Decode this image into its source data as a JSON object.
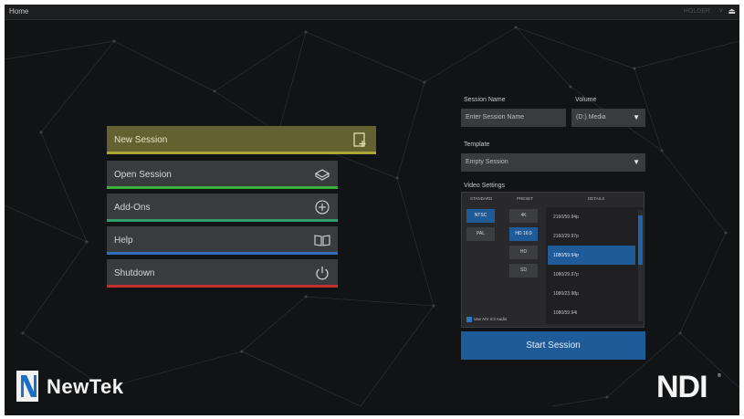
{
  "window": {
    "title": "Home",
    "right_text": "HOLDER",
    "right_chevron": "˅",
    "eject_glyph": "⏏"
  },
  "menu": {
    "items": [
      {
        "label": "New Session",
        "icon": "new-session-icon",
        "accent": "#a9a836"
      },
      {
        "label": "Open Session",
        "icon": "open-session-icon",
        "accent": "#3cae3a"
      },
      {
        "label": "Add-Ons",
        "icon": "add-ons-icon",
        "accent": "#2f9a6a"
      },
      {
        "label": "Help",
        "icon": "help-book-icon",
        "accent": "#2f6dbf"
      },
      {
        "label": "Shutdown",
        "icon": "power-icon",
        "accent": "#c33030"
      }
    ]
  },
  "session": {
    "name_label": "Session Name",
    "name_placeholder": "Enter Session Name",
    "volume_label": "Volume",
    "volume_value": "(D:) Media",
    "template_label": "Template",
    "template_value": "Empty Session",
    "video_settings_label": "Video Settings",
    "columns": {
      "standard": "STANDARD",
      "preset": "PRESET",
      "details": "DETAILS"
    },
    "standards": [
      "NTSC",
      "PAL"
    ],
    "standard_selected": "NTSC",
    "presets": [
      "4K",
      "HD 16:9",
      "HD",
      "SD"
    ],
    "preset_selected": "HD 16:9",
    "details": [
      "2160/59.94p",
      "2160/29.97p",
      "1080/59.94p",
      "1080/29.97p",
      "1080/23.98p",
      "1080/59.94i"
    ],
    "details_selected": "1080/59.94p",
    "checkbox_label": "Use A/V 4:3 Audio",
    "checkbox_checked": true,
    "start_label": "Start Session",
    "accent": "#1f5a99"
  },
  "branding": {
    "newtek_text": "NewTek",
    "ndi_text": "NDI",
    "ndi_mark": "®"
  }
}
